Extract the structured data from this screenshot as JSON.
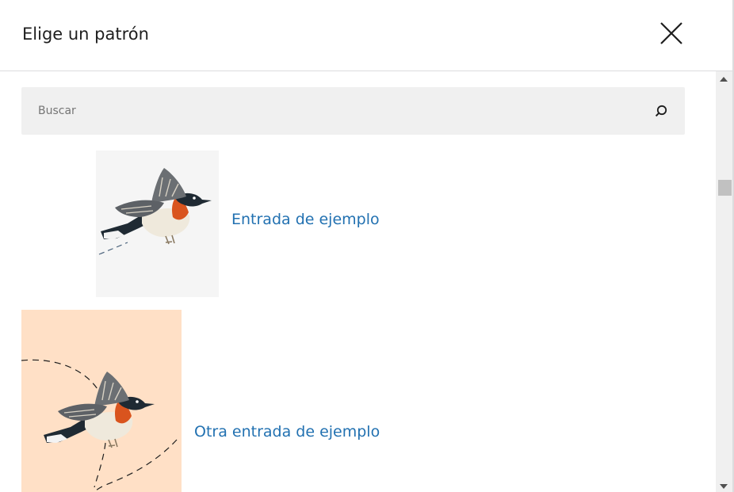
{
  "dialog": {
    "title": "Elige un patrón"
  },
  "search": {
    "placeholder": "Buscar",
    "value": ""
  },
  "patterns": [
    {
      "title": "Entrada de ejemplo",
      "thumbnail_icon": "bird-illustration-icon",
      "thumbnail_background": "#f5f5f5"
    },
    {
      "title": "Otra entrada de ejemplo",
      "thumbnail_icon": "bird-illustration-icon",
      "thumbnail_background": "#ffe0c6"
    }
  ],
  "colors": {
    "link": "#2271b1",
    "text": "#1e1e1e",
    "search_bg": "#f0f0f0",
    "border": "#dcdcde"
  }
}
